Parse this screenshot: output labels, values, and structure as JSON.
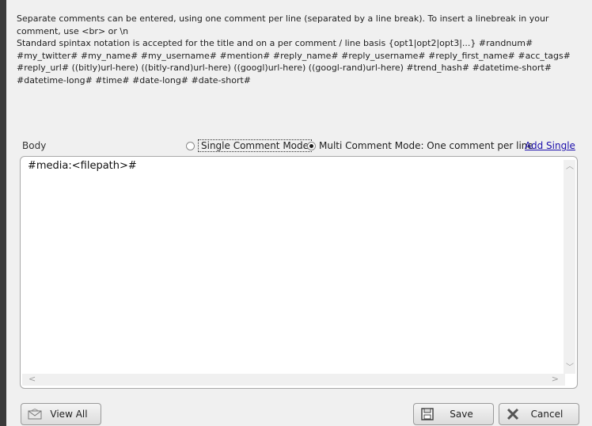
{
  "instructions": {
    "line1": "Separate comments can be entered, using one comment per line (separated by a line break). To insert a linebreak in your comment, use <br> or \\n",
    "line2": "Standard spintax notation is accepted for the title and on a per comment / line basis {opt1|opt2|opt3|...} #randnum# #my_twitter# #my_name# #my_username# #mention# #reply_name# #reply_username# #reply_first_name# #acc_tags# #reply_url# ((bitly)url-here) ((bitly-rand)url-here) ((googl)url-here) ((googl-rand)url-here) #trend_hash# #datetime-short# #datetime-long# #time# #date-long# #date-short#"
  },
  "body_label": "Body",
  "mode": {
    "single_label": "Single Comment Mode",
    "multi_label": "Multi Comment Mode: One comment per line",
    "selected": "multi"
  },
  "add_single_link": "Add Single",
  "editor": {
    "content": "#media:<filepath>#"
  },
  "buttons": {
    "view_all": "View All",
    "save": "Save",
    "cancel": "Cancel"
  },
  "icons": {
    "view_all": "mail-icon",
    "save": "floppy-disk-icon",
    "cancel": "x-icon"
  }
}
